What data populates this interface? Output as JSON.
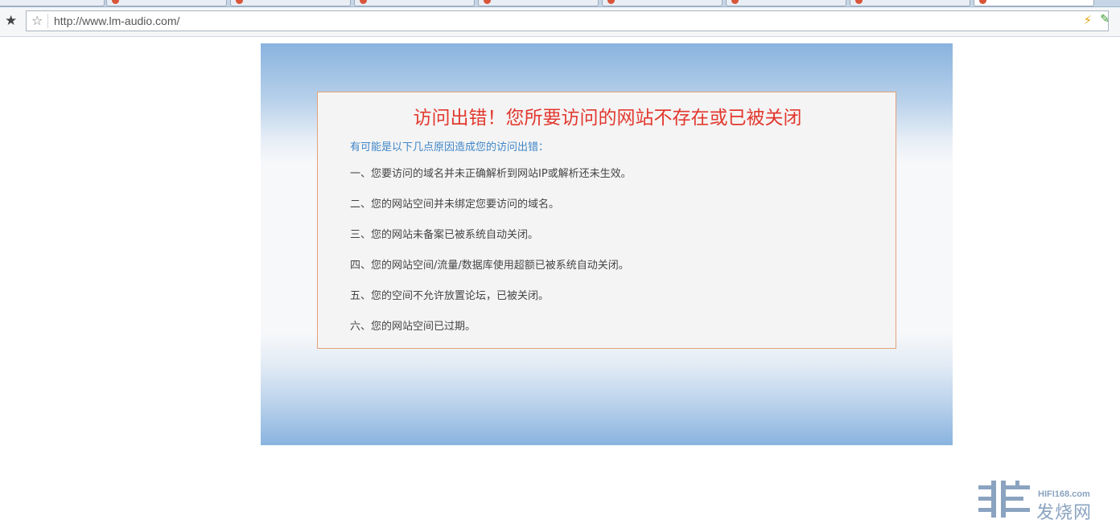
{
  "browser": {
    "url": "http://www.lm-audio.com/",
    "tab_count": 9
  },
  "page": {
    "title": "访问出错！您所要访问的网站不存在或已被关闭",
    "subtitle": "有可能是以下几点原因造成您的访问出错：",
    "reasons": [
      "一、您要访问的域名并未正确解析到网站IP或解析还未生效。",
      "二、您的网站空间并未绑定您要访问的域名。",
      "三、您的网站未备案已被系统自动关闭。",
      "四、您的网站空间/流量/数据库使用超额已被系统自动关闭。",
      "五、您的空间不允许放置论坛，已被关闭。",
      "六、您的网站空间已过期。"
    ]
  },
  "watermark": {
    "domain": "HIFI168.com",
    "name": "发烧网"
  },
  "colors": {
    "title_red": "#e2392f",
    "subtitle_blue": "#3f86c8",
    "box_border": "#e3a176",
    "panel_blue": "#89b3df"
  }
}
